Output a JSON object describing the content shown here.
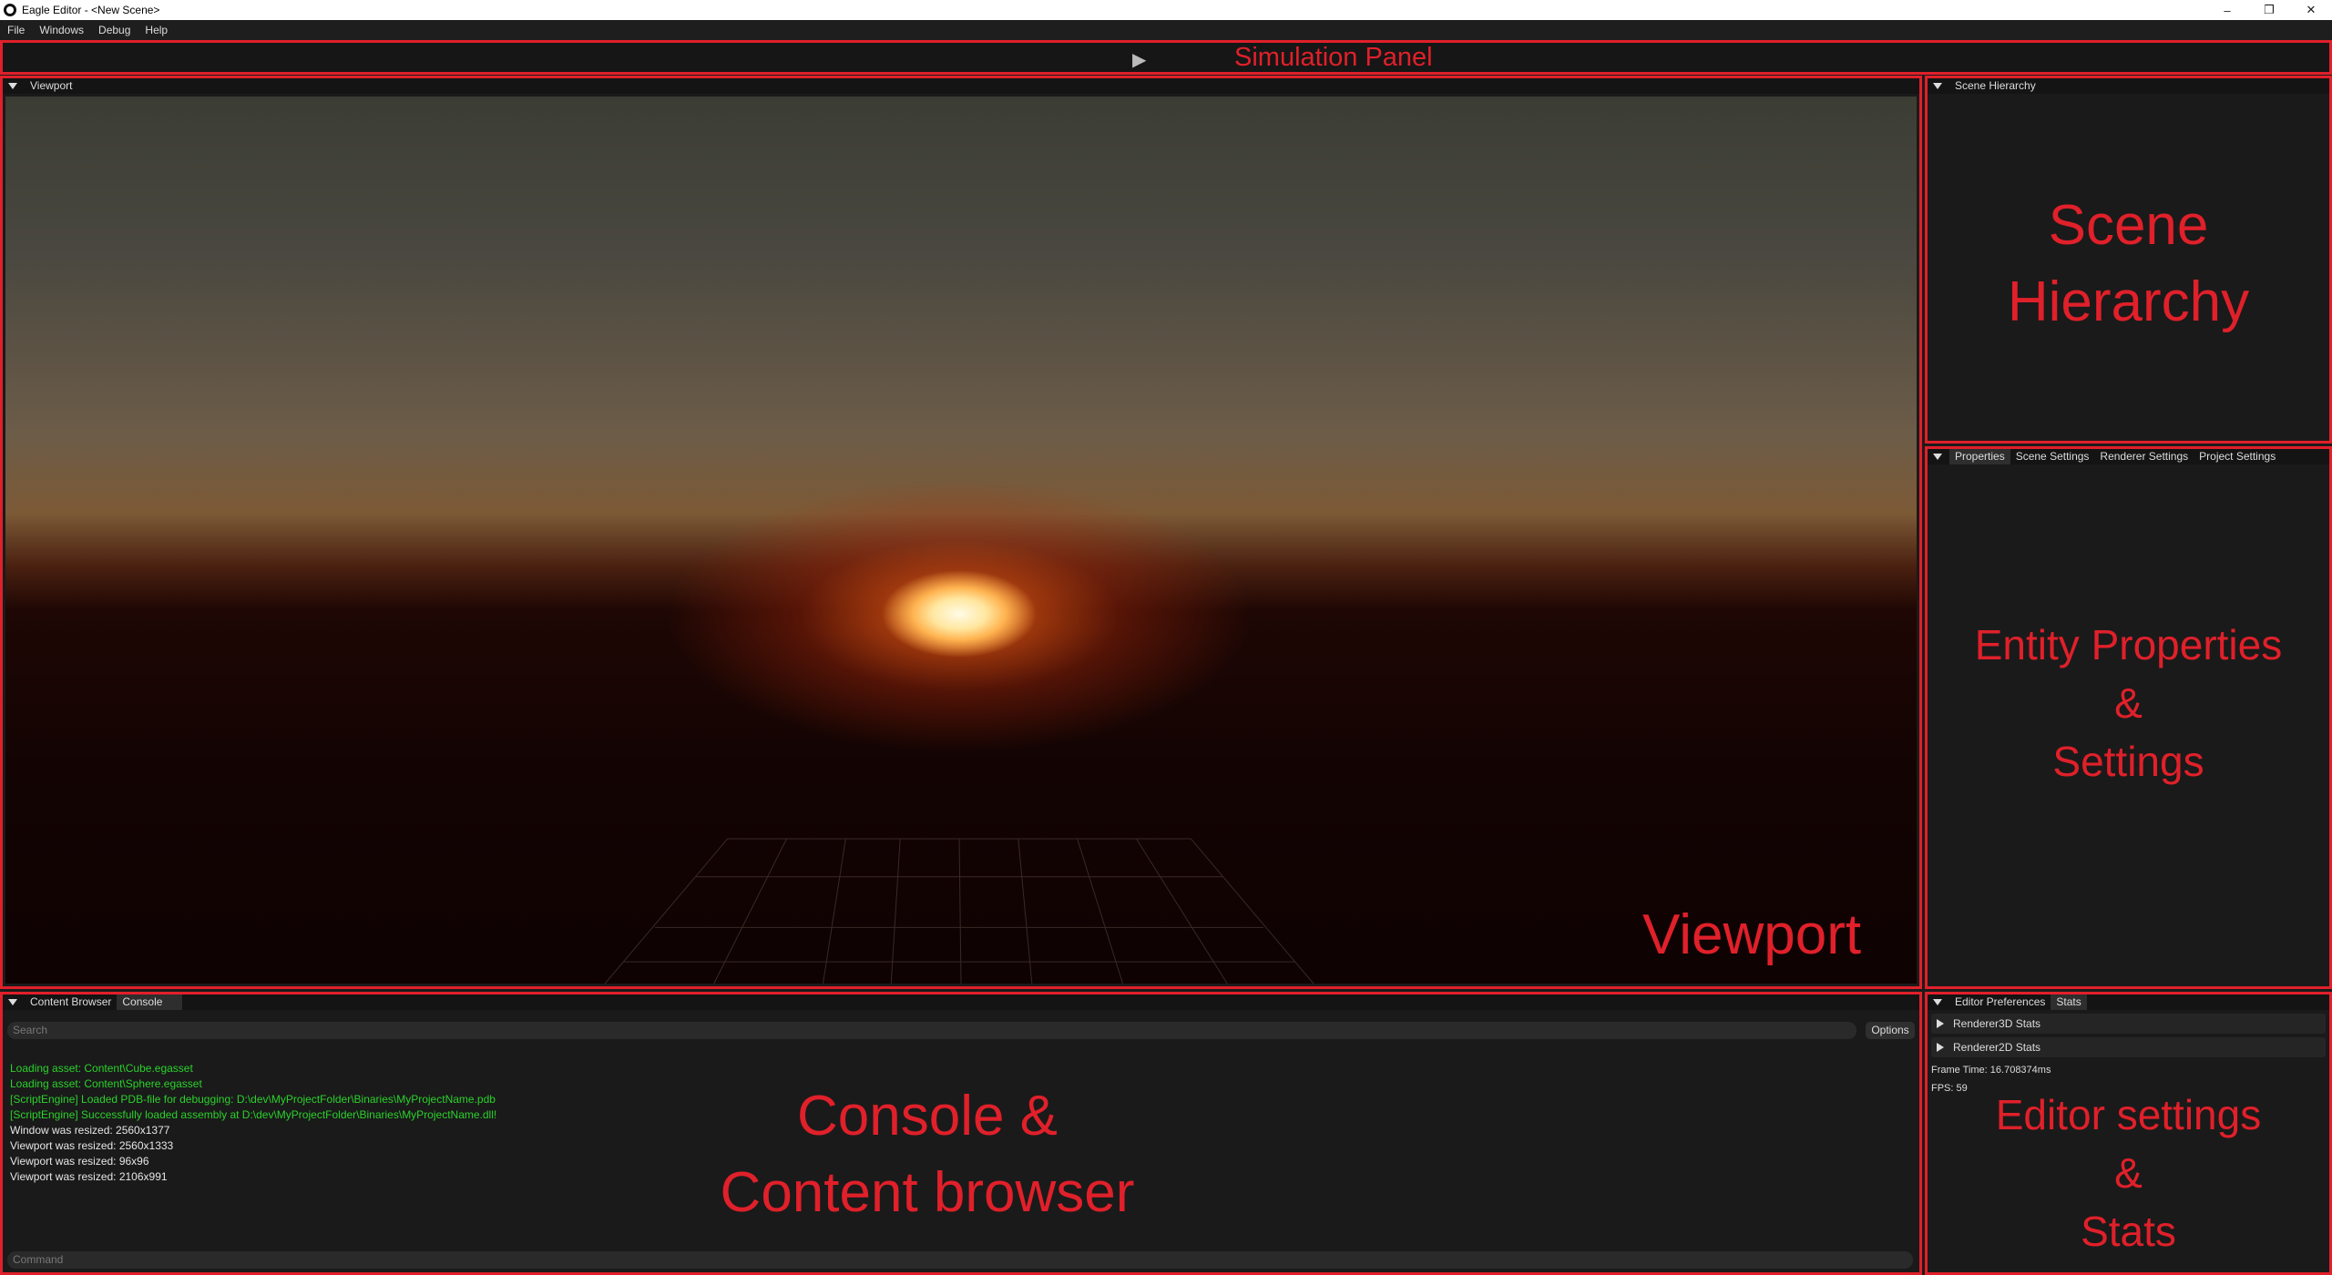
{
  "window": {
    "title": "Eagle Editor - <New Scene>",
    "controls": [
      "–",
      "❐",
      "✕"
    ]
  },
  "menu": [
    "File",
    "Windows",
    "Debug",
    "Help"
  ],
  "simulation": {
    "play_icon": "▶",
    "label": "Simulation Panel"
  },
  "viewport": {
    "tab": "Viewport",
    "overlay": "Viewport"
  },
  "hierarchy": {
    "tab": "Scene Hierarchy",
    "overlay_line1": "Scene",
    "overlay_line2": "Hierarchy"
  },
  "properties": {
    "tabs": [
      "Properties",
      "Scene Settings",
      "Renderer Settings",
      "Project Settings"
    ],
    "overlay_line1": "Entity Properties",
    "overlay_line2": "&",
    "overlay_line3": "Settings"
  },
  "console": {
    "tabs": [
      "Content Browser",
      "Console"
    ],
    "search_placeholder": "Search",
    "options_label": "Options",
    "lines": [
      "Loading asset: Content\\Cube.egasset",
      "Loading asset: Content\\Sphere.egasset",
      "[ScriptEngine] Loaded PDB-file for debugging: D:\\dev\\MyProjectFolder\\Binaries\\MyProjectName.pdb",
      "[ScriptEngine] Successfully loaded assembly at D:\\dev\\MyProjectFolder\\Binaries\\MyProjectName.dll!",
      "Window was resized: 2560x1377",
      "Viewport was resized: 2560x1333",
      "Viewport was resized: 96x96",
      "Viewport was resized: 2106x991"
    ],
    "command_placeholder": "Command",
    "overlay_line1": "Console &",
    "overlay_line2": "Content browser"
  },
  "editor": {
    "tabs": [
      "Editor Preferences",
      "Stats"
    ],
    "stats": [
      "Renderer3D Stats",
      "Renderer2D Stats"
    ],
    "frame_time": "Frame Time: 16.708374ms",
    "fps": "FPS: 59",
    "overlay_line1": "Editor settings",
    "overlay_line2": "&",
    "overlay_line3": "Stats"
  },
  "colors": {
    "accent": "#e0202a",
    "log_green": "#2bd12b"
  }
}
